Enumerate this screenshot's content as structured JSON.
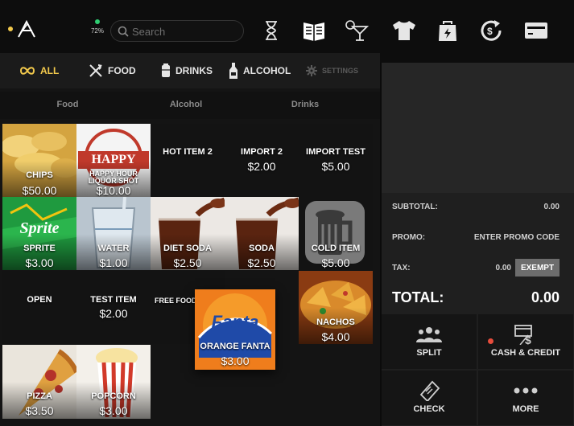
{
  "header": {
    "battery_pct": "72%",
    "search_placeholder": "Search"
  },
  "tabs": [
    {
      "label": "ALL",
      "icon": "infinity-icon"
    },
    {
      "label": "FOOD",
      "icon": "utensils-icon"
    },
    {
      "label": "DRINKS",
      "icon": "can-icon"
    },
    {
      "label": "ALCOHOL",
      "icon": "bottle-icon"
    },
    {
      "label": "SETTINGS",
      "icon": "gear-icon"
    }
  ],
  "categories": [
    "Food",
    "Alcohol",
    "Drinks"
  ],
  "items": [
    {
      "name": "CHIPS",
      "price": "$50.00"
    },
    {
      "name": "HAPPY HOUR LIQUOR SHOT",
      "price": "$10.00",
      "logo_text": "HAPPY HOUR"
    },
    {
      "name": "HOT ITEM 2",
      "price": ""
    },
    {
      "name": "IMPORT 2",
      "price": "$2.00"
    },
    {
      "name": "IMPORT TEST",
      "price": "$5.00"
    },
    {
      "name": "SPRITE",
      "price": "$3.00",
      "logo_text": "Sprite"
    },
    {
      "name": "WATER",
      "price": "$1.00"
    },
    {
      "name": "DIET SODA",
      "price": "$2.50"
    },
    {
      "name": "SODA",
      "price": "$2.50"
    },
    {
      "name": "COLD ITEM",
      "price": "$5.00"
    },
    {
      "name": "OPEN",
      "price": ""
    },
    {
      "name": "TEST ITEM",
      "price": "$2.00"
    },
    {
      "name": "FREE FOOD",
      "price": ""
    },
    {
      "name": "ORANGE FANTA",
      "price": "$3.00",
      "logo_text": "Fanta"
    },
    {
      "name": "NACHOS",
      "price": "$4.00"
    },
    {
      "name": "PIZZA",
      "price": "$3.50"
    },
    {
      "name": "POPCORN",
      "price": "$3.00"
    }
  ],
  "summary": {
    "subtotal_label": "SUBTOTAL:",
    "subtotal_value": "0.00",
    "promo_label": "PROMO:",
    "promo_value": "ENTER PROMO CODE",
    "tax_label": "TAX:",
    "tax_value": "0.00",
    "exempt_label": "EXEMPT",
    "total_label": "TOTAL:",
    "total_value": "0.00"
  },
  "actions": {
    "split": "SPLIT",
    "cash_credit": "CASH & CREDIT",
    "check": "CHECK",
    "more": "MORE"
  },
  "colors": {
    "accent": "#f2c94c",
    "status_dot": "#2ecc71",
    "alert_dot": "#e74c3c"
  }
}
